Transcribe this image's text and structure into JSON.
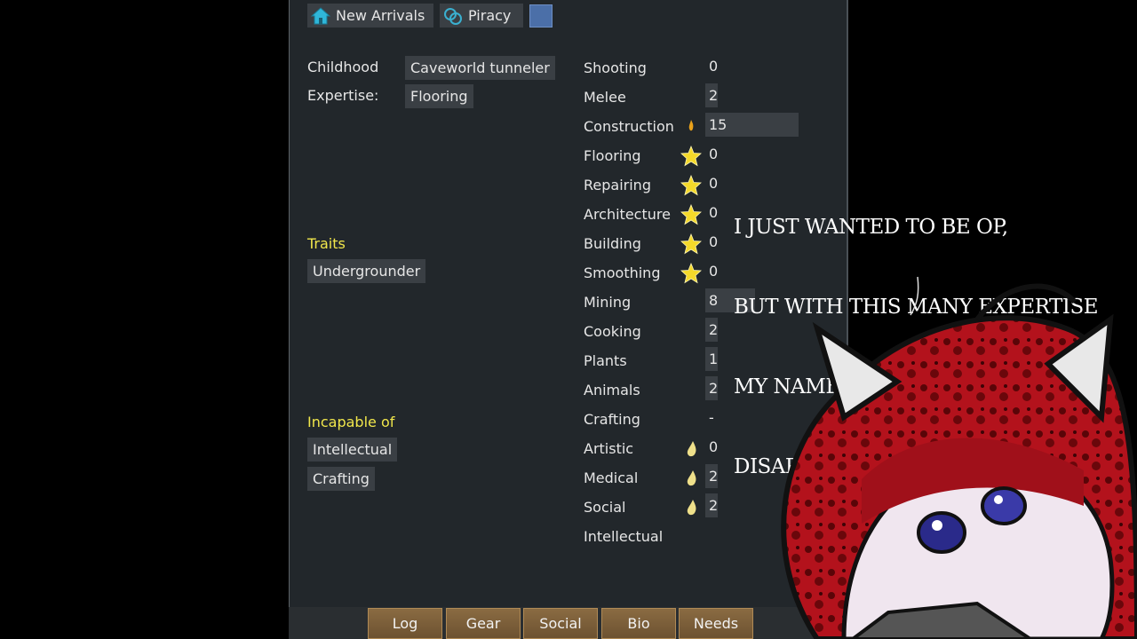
{
  "top_tabs": [
    {
      "label": "New Arrivals",
      "icon": "home-icon"
    },
    {
      "label": "Piracy",
      "icon": "faction-icon"
    }
  ],
  "backstory": {
    "childhood_label": "Childhood",
    "childhood_value": "Caveworld tunneler",
    "expertise_label": "Expertise:",
    "expertise_value": "Flooring"
  },
  "traits": {
    "heading": "Traits",
    "items": [
      "Undergrounder"
    ]
  },
  "incapable": {
    "heading": "Incapable of",
    "items": [
      "Intellectual",
      "Crafting"
    ]
  },
  "skills": [
    {
      "name": "Shooting",
      "value": "0",
      "passion": "none",
      "level": 0
    },
    {
      "name": "Melee",
      "value": "2",
      "passion": "none",
      "level": 2
    },
    {
      "name": "Construction",
      "value": "15",
      "passion": "flame",
      "level": 15
    },
    {
      "name": "Flooring",
      "value": "0",
      "passion": "star",
      "level": 0
    },
    {
      "name": "Repairing",
      "value": "0",
      "passion": "star",
      "level": 0
    },
    {
      "name": "Architecture",
      "value": "0",
      "passion": "star",
      "level": 0
    },
    {
      "name": "Building",
      "value": "0",
      "passion": "star",
      "level": 0
    },
    {
      "name": "Smoothing",
      "value": "0",
      "passion": "star",
      "level": 0
    },
    {
      "name": "Mining",
      "value": "8",
      "passion": "none",
      "level": 8
    },
    {
      "name": "Cooking",
      "value": "2",
      "passion": "none",
      "level": 2
    },
    {
      "name": "Plants",
      "value": "1",
      "passion": "none",
      "level": 1
    },
    {
      "name": "Animals",
      "value": "2",
      "passion": "none",
      "level": 2
    },
    {
      "name": "Crafting",
      "value": "-",
      "passion": "none",
      "level": 0
    },
    {
      "name": "Artistic",
      "value": "0",
      "passion": "flame-small",
      "level": 0
    },
    {
      "name": "Medical",
      "value": "2",
      "passion": "flame-small",
      "level": 2
    },
    {
      "name": "Social",
      "value": "2",
      "passion": "flame-small",
      "level": 2
    },
    {
      "name": "Intellectual",
      "value": "",
      "passion": "none",
      "level": 0
    }
  ],
  "bottom_tabs": [
    "Log",
    "Gear",
    "Social",
    "Bio",
    "Needs"
  ],
  "caption_lines": [
    "I JUST WANTED TO BE OP,",
    "BUT WITH THIS MANY EXPERTISE",
    "MY NAME AGE RACE ETC",
    "DISAPPEAR OFF THE SCREEN ;_;"
  ],
  "colors": {
    "panel": "#22272b",
    "chip": "#3a3f44",
    "heading": "#f0e64b",
    "tab": "#7a5e3a"
  }
}
